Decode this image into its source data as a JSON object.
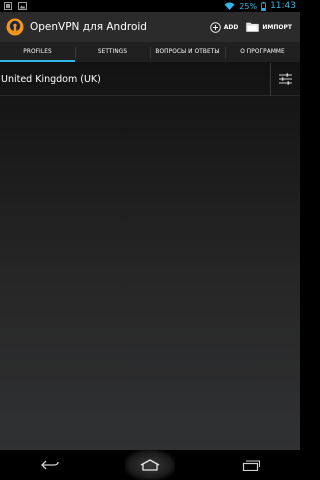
{
  "status_bar": {
    "battery_percent": "25%",
    "time": "11:43",
    "icons": [
      "notification-icon",
      "image-icon",
      "wifi-icon",
      "battery-icon"
    ],
    "accent": "#33b5e5"
  },
  "action_bar": {
    "title": "OpenVPN для Android",
    "add_label": "ADD",
    "import_label": "ИМПОРТ",
    "logo_color": "#f7941d"
  },
  "tabs": [
    {
      "label": "PROFILES",
      "active": true
    },
    {
      "label": "SETTINGS",
      "active": false
    },
    {
      "label": "ВОПРОСЫ И ОТВЕТЫ",
      "active": false
    },
    {
      "label": "О ПРОГРАММЕ",
      "active": false
    }
  ],
  "profiles": [
    {
      "name": "United Kingdom (UK)"
    }
  ],
  "nav": {
    "icons": [
      "back-icon",
      "home-icon",
      "recent-apps-icon"
    ]
  }
}
